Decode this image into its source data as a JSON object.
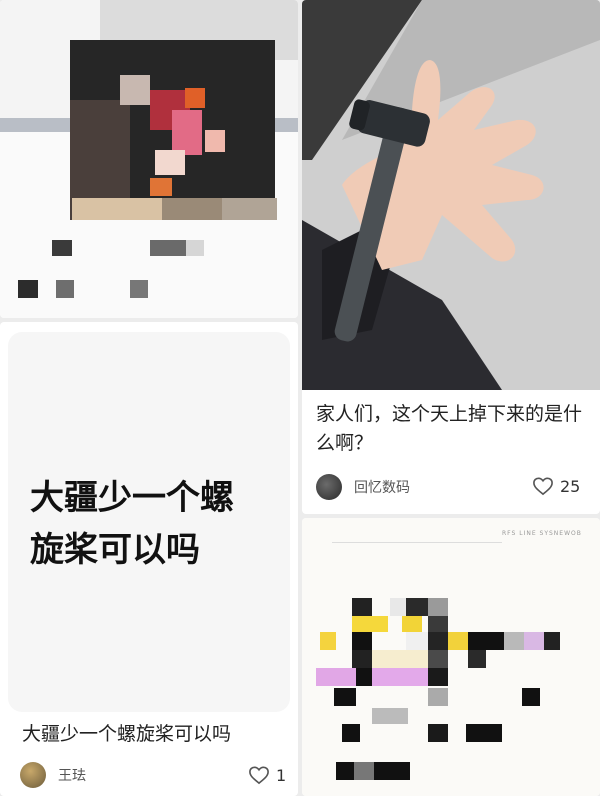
{
  "cards": [
    {
      "image_caption": "大疆少一个螺旋桨可以吗",
      "title": "大疆少一个螺旋桨可以吗",
      "author": "王珐",
      "likes": "1"
    },
    {
      "title": "家人们，这个天上掉下来的是什么啊？",
      "author": "回忆数码",
      "likes": "25"
    },
    {
      "header_text": "RFS LINE SYSNEWOB"
    }
  ],
  "icons": {
    "like": "heart-icon"
  },
  "colors": {
    "page_bg": "#ececec",
    "card_bg": "#ffffff",
    "title_text": "#222222",
    "author_text": "#555555"
  }
}
